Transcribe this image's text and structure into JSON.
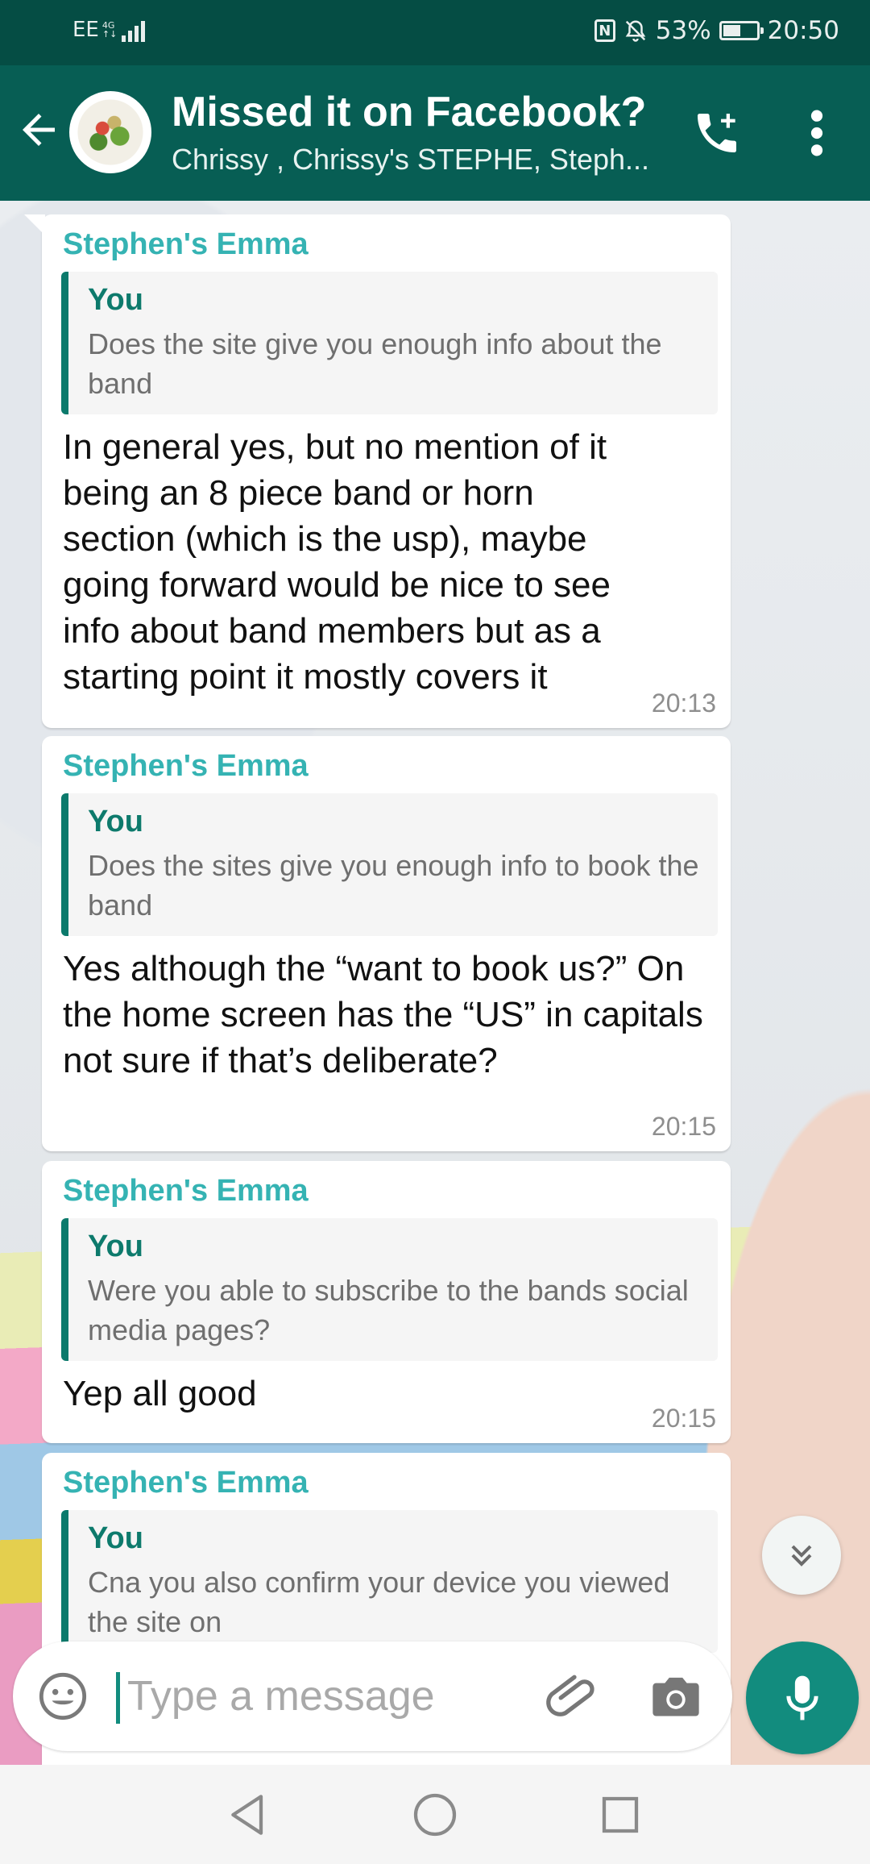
{
  "status_bar": {
    "carrier": "EE",
    "network_top": "4G",
    "network_bottom": "↑↓",
    "nfc_label": "N",
    "battery_percent": "53%",
    "battery_level": 0.53,
    "time": "20:50"
  },
  "header": {
    "title": "Missed it on Facebook?",
    "participants": "Chrissy , Chrissy's STEPHE, Steph...",
    "icons": {
      "back": "arrow-left-icon",
      "call": "add-call-icon",
      "menu": "more-vert-icon"
    }
  },
  "colors": {
    "header": "#075e54",
    "status_bar": "#054d44",
    "accent": "#128c7e",
    "sender": "#35b3b3",
    "quote_bar": "#0c7a6c"
  },
  "messages": [
    {
      "sender": "Stephen's Emma",
      "quote_author": "You",
      "quote_text": "Does the site give you enough info about the band",
      "text": "In general yes, but no mention of it being an 8 piece band or horn section (which is the usp), maybe going forward would be nice to see info about band members but as a starting point it mostly covers it",
      "time": "20:13"
    },
    {
      "sender": "Stephen's Emma",
      "quote_author": "You",
      "quote_text": "Does the sites give you enough info to book the band",
      "text": "Yes although the “want to book us?” On the home screen has the “US” in capitals not sure if that’s deliberate?",
      "time": "20:15"
    },
    {
      "sender": "Stephen's Emma",
      "quote_author": "You",
      "quote_text": "Were you able to subscribe to the bands social media pages?",
      "text": "Yep all good",
      "time": "20:15"
    },
    {
      "sender": "Stephen's Emma",
      "quote_author": "You",
      "quote_text": "Cna you also confirm your device you viewed the site on",
      "text": "",
      "time": ""
    }
  ],
  "composer": {
    "placeholder": "Type a message",
    "icons": {
      "emoji": "emoji-icon",
      "attach": "paperclip-icon",
      "camera": "camera-icon",
      "mic": "microphone-icon"
    }
  },
  "scroll_button": {
    "icon": "double-chevron-down-icon"
  },
  "nav_bar": {
    "icons": [
      "triangle-back-icon",
      "circle-home-icon",
      "square-recents-icon"
    ]
  }
}
